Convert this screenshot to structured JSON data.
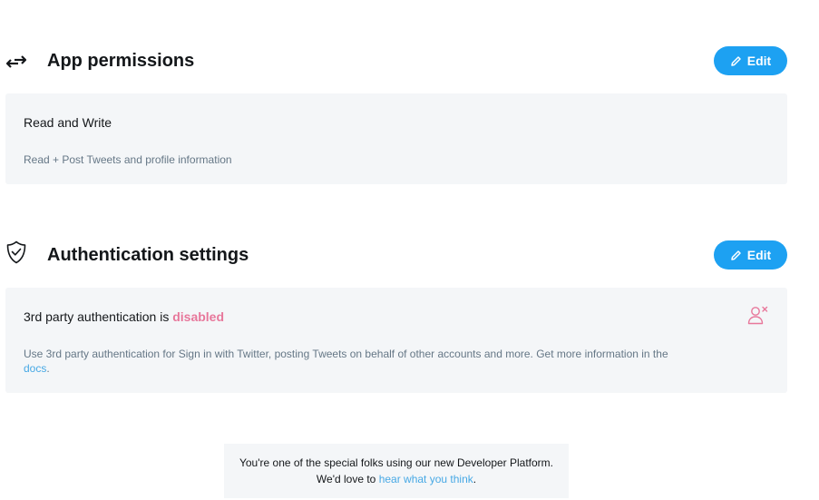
{
  "permissions": {
    "title": "App permissions",
    "icon": "swap-arrows-icon",
    "edit_label": "Edit",
    "card": {
      "title": "Read and Write",
      "description": "Read + Post Tweets and profile information"
    }
  },
  "authentication": {
    "title": "Authentication settings",
    "icon": "shield-check-icon",
    "edit_label": "Edit",
    "card": {
      "title_prefix": "3rd party authentication is",
      "status": "disabled",
      "description": "Use 3rd party authentication for Sign in with Twitter, posting Tweets on behalf of other accounts and more. Get more information in the",
      "docs_link": "docs",
      "docs_suffix": ".",
      "status_icon": "user-x-icon"
    }
  },
  "feedback": {
    "line1": "You're one of the special folks using our new Developer Platform.",
    "line2_prefix": "We'd love to",
    "link": "hear what you think",
    "line2_suffix": "."
  },
  "colors": {
    "accent": "#1da1f2",
    "card_bg": "#f4f6f8",
    "disabled": "#e0245e",
    "muted_text": "#657786"
  }
}
